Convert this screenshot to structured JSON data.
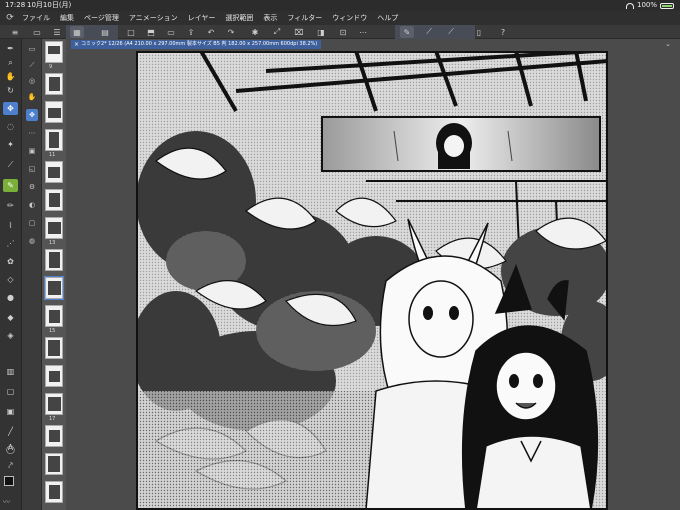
{
  "status": {
    "time": "17:28",
    "date": "10月10日(月)",
    "battery": "100%"
  },
  "menu": {
    "items": [
      "ファイル",
      "編集",
      "ページ管理",
      "アニメーション",
      "レイヤー",
      "選択範囲",
      "表示",
      "フィルター",
      "ウィンドウ",
      "ヘルプ"
    ]
  },
  "document": {
    "tab_label": "コミック2* 12/26 (A4 210.00 x 297.00mm 製本サイズ B5 判 182.00 x 257.00mm 600dpi 38.2%)"
  },
  "pages": {
    "numbers": [
      "9",
      "11",
      "13",
      "15",
      "17"
    ]
  },
  "toolbar": {
    "icons": [
      "pen-nib-icon",
      "zoom-icon",
      "hand-icon",
      "rotate-icon",
      "move-icon",
      "lasso-icon",
      "wand-icon",
      "eyedropper-icon",
      "pen-icon",
      "pencil-icon",
      "brush-icon",
      "airbrush-icon",
      "decoration-icon",
      "eraser-icon",
      "blend-icon",
      "fill-icon",
      "gradient-icon",
      "figure-icon",
      "frame-icon",
      "line-icon",
      "balloon-icon",
      "text-icon",
      "correct-line-icon"
    ]
  },
  "colors": {
    "main": "#111111",
    "sub": "#ffffff",
    "accent": "#4e7fcc"
  }
}
